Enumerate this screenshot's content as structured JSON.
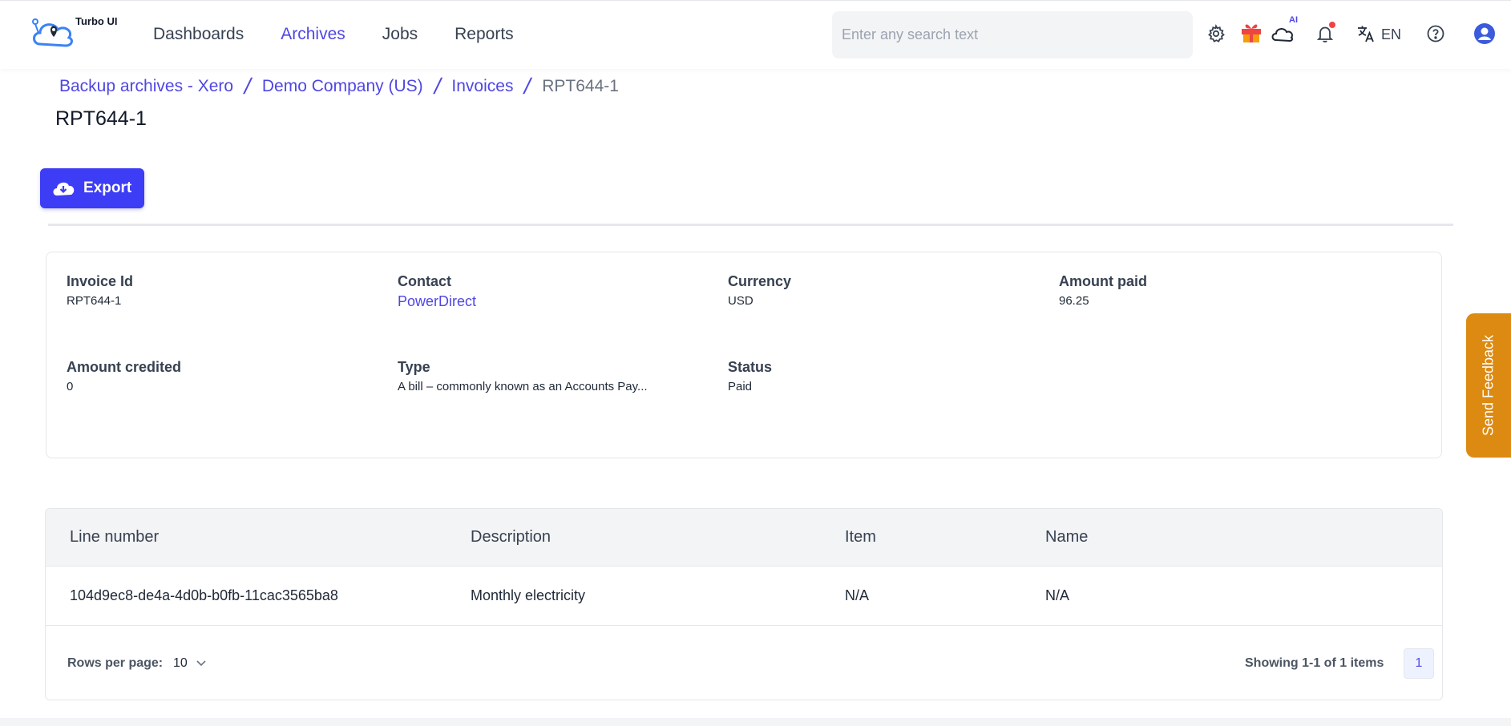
{
  "app": {
    "logo_text": "Turbo UI"
  },
  "nav": {
    "items": [
      {
        "label": "Dashboards",
        "active": false
      },
      {
        "label": "Archives",
        "active": true
      },
      {
        "label": "Jobs",
        "active": false
      },
      {
        "label": "Reports",
        "active": false
      }
    ]
  },
  "search": {
    "placeholder": "Enter any search text",
    "value": ""
  },
  "header_icons": {
    "settings": "gear-icon",
    "gift": "gift-icon",
    "ai_cloud": "ai-cloud-icon",
    "ai_label": "AI",
    "notifications": "bell-icon",
    "translate": "translate-icon",
    "language": "EN",
    "help": "help-icon",
    "account": "user-avatar-icon"
  },
  "breadcrumb": {
    "items": [
      "Backup archives - Xero",
      "Demo Company (US)",
      "Invoices"
    ],
    "current": "RPT644-1"
  },
  "page": {
    "title": "RPT644-1",
    "export_label": "Export"
  },
  "details": {
    "invoice_id": {
      "label": "Invoice Id",
      "value": "RPT644-1"
    },
    "contact": {
      "label": "Contact",
      "value": "PowerDirect"
    },
    "currency": {
      "label": "Currency",
      "value": "USD"
    },
    "amount_paid": {
      "label": "Amount paid",
      "value": "96.25"
    },
    "amount_credited": {
      "label": "Amount credited",
      "value": "0"
    },
    "type": {
      "label": "Type",
      "value": "A bill – commonly known as an Accounts Pay..."
    },
    "status": {
      "label": "Status",
      "value": "Paid"
    }
  },
  "table": {
    "columns": [
      "Line number",
      "Description",
      "Item",
      "Name"
    ],
    "rows": [
      [
        "104d9ec8-de4a-4d0b-b0fb-11cac3565ba8",
        "Monthly electricity",
        "N/A",
        "N/A"
      ]
    ],
    "rows_per_page_label": "Rows per page:",
    "rows_per_page": "10",
    "showing": "Showing 1-1 of 1 items",
    "current_page": "1"
  },
  "feedback": {
    "label": "Send Feedback"
  },
  "colors": {
    "accent": "#4f46e5",
    "export_button": "#3d3df5",
    "feedback": "#dc8a12",
    "notification_dot": "#ef4444"
  }
}
